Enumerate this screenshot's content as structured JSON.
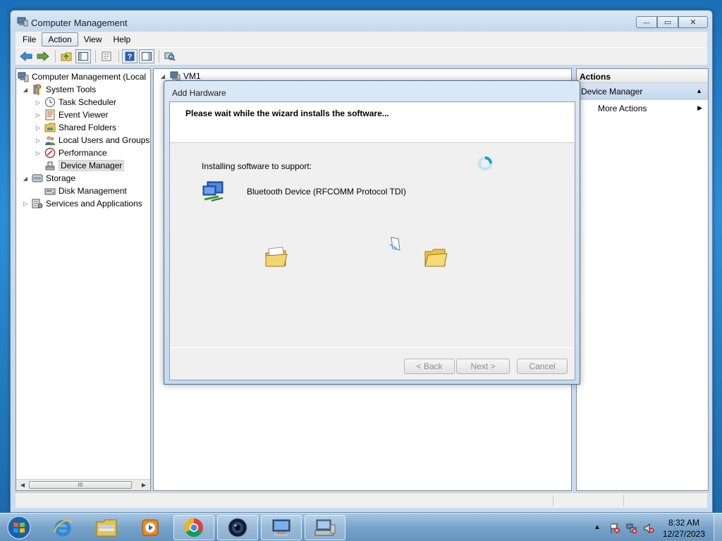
{
  "window": {
    "title": "Computer Management",
    "controls": {
      "minimize": "—",
      "maximize": "▭",
      "close": "✕"
    }
  },
  "menubar": {
    "items": [
      "File",
      "Action",
      "View",
      "Help"
    ],
    "active": "Action"
  },
  "tree": {
    "root": "Computer Management (Local",
    "system_tools": "System Tools",
    "task_scheduler": "Task Scheduler",
    "event_viewer": "Event Viewer",
    "shared_folders": "Shared Folders",
    "local_users": "Local Users and Groups",
    "performance": "Performance",
    "device_manager": "Device Manager",
    "storage": "Storage",
    "disk_management": "Disk Management",
    "services": "Services and Applications",
    "scroll_grip": "III"
  },
  "main": {
    "node": "VM1"
  },
  "actions": {
    "header": "Actions",
    "section": "Device Manager",
    "more": "More Actions"
  },
  "dialog": {
    "title": "Add Hardware",
    "heading": "Please wait while the wizard installs the software...",
    "install_label": "Installing software to support:",
    "device_name": "Bluetooth Device (RFCOMM Protocol TDI)",
    "back": "< Back",
    "next": "Next >",
    "cancel": "Cancel"
  },
  "taskbar": {
    "time": "8:32 AM",
    "date": "12/27/2023",
    "apps": [
      "internet-explorer",
      "file-explorer",
      "media-player",
      "chrome",
      "camera",
      "remote-desktop",
      "computer-management"
    ]
  }
}
